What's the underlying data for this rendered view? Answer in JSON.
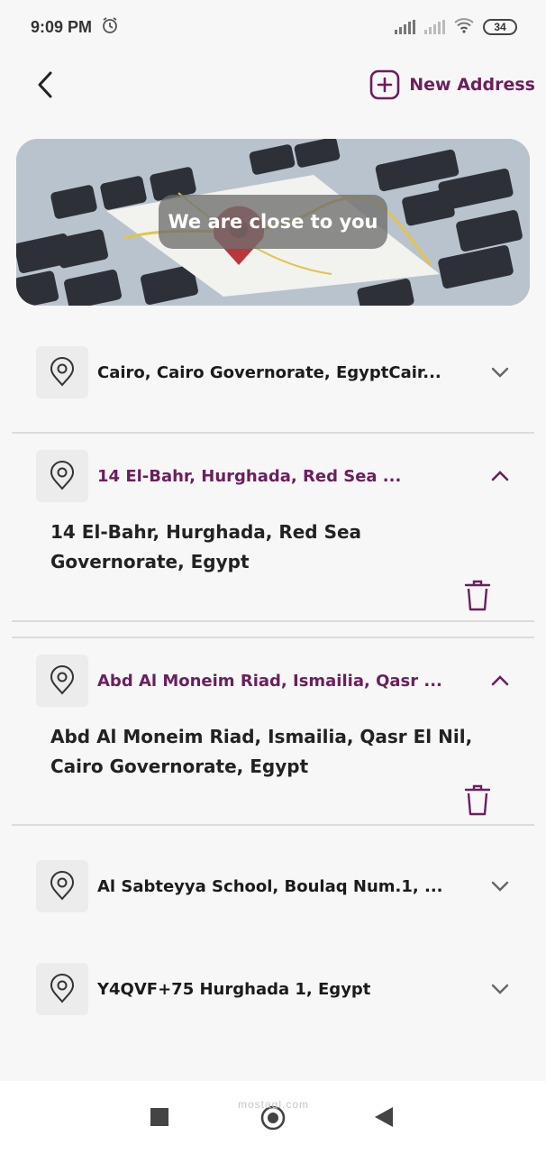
{
  "status_bar": {
    "time": "9:09 PM",
    "battery": "34"
  },
  "header": {
    "new_address_label": "New Address"
  },
  "banner": {
    "text": "We are close to you"
  },
  "addresses": [
    {
      "title": "Cairo, Cairo Governorate, EgyptCair...",
      "expanded": false
    },
    {
      "title": "14 El-Bahr, Hurghada, Red Sea ...",
      "expanded": true,
      "full": "14 El-Bahr, Hurghada, Red Sea Governorate, Egypt"
    },
    {
      "title": "Abd Al Moneim Riad, Ismailia, Qasr ...",
      "expanded": true,
      "full": "Abd Al Moneim Riad, Ismailia, Qasr El Nil, Cairo Governorate, Egypt"
    },
    {
      "title": "Al Sabteyya School, Boulaq Num.1, ...",
      "expanded": false
    },
    {
      "title": "Y4QVF+75 Hurghada 1, Egypt",
      "expanded": false
    }
  ],
  "watermark": "mostaql.com",
  "colors": {
    "accent": "#6b1f5c",
    "background": "#f7f7f7"
  },
  "icons": [
    "alarm-icon",
    "signal-icon",
    "wifi-icon",
    "battery-icon",
    "back-arrow-icon",
    "plus-square-icon",
    "location-pin-icon",
    "chevron-down-icon",
    "chevron-up-icon",
    "trash-icon",
    "nav-recents-icon",
    "nav-home-icon",
    "nav-back-icon"
  ]
}
